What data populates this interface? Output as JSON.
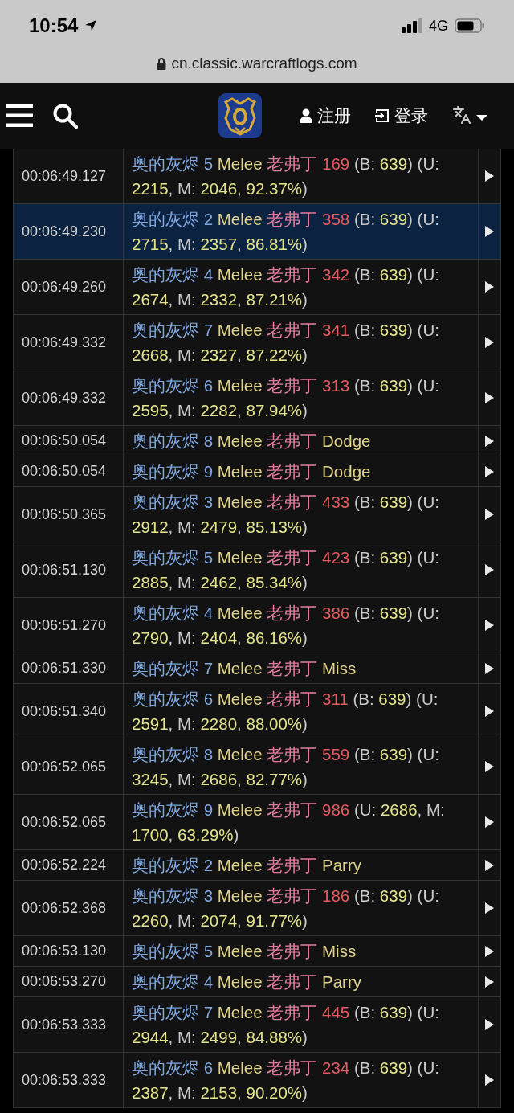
{
  "status_bar": {
    "time": "10:54",
    "network": "4G"
  },
  "address_bar": {
    "url": "cn.classic.warcraftlogs.com"
  },
  "nav": {
    "register": "注册",
    "login": "登录"
  },
  "events": [
    {
      "time": "00:06:49.127",
      "selected": false,
      "segments": [
        {
          "text": "奥的灰烬 5 ",
          "kind": "source"
        },
        {
          "text": "Melee ",
          "kind": "ability"
        },
        {
          "text": "老弗丁 ",
          "kind": "target"
        },
        {
          "text": "169",
          "kind": "damage"
        },
        {
          "text": " (B: ",
          "kind": "plain"
        },
        {
          "text": "639",
          "kind": "number"
        },
        {
          "text": ") (U: ",
          "kind": "plain"
        },
        {
          "text": "2215",
          "kind": "number"
        },
        {
          "text": ", M: ",
          "kind": "plain"
        },
        {
          "text": "2046",
          "kind": "number"
        },
        {
          "text": ", ",
          "kind": "plain"
        },
        {
          "text": "92.37%",
          "kind": "number"
        },
        {
          "text": ")",
          "kind": "plain"
        }
      ]
    },
    {
      "time": "00:06:49.230",
      "selected": true,
      "segments": [
        {
          "text": "奥的灰烬 2 ",
          "kind": "source"
        },
        {
          "text": "Melee ",
          "kind": "ability"
        },
        {
          "text": "老弗丁 ",
          "kind": "target"
        },
        {
          "text": "358",
          "kind": "damage"
        },
        {
          "text": " (B: ",
          "kind": "plain"
        },
        {
          "text": "639",
          "kind": "number"
        },
        {
          "text": ") (U: ",
          "kind": "plain"
        },
        {
          "text": "2715",
          "kind": "number"
        },
        {
          "text": ", M: ",
          "kind": "plain"
        },
        {
          "text": "2357",
          "kind": "number"
        },
        {
          "text": ", ",
          "kind": "plain"
        },
        {
          "text": "86.81%",
          "kind": "number"
        },
        {
          "text": ")",
          "kind": "plain"
        }
      ]
    },
    {
      "time": "00:06:49.260",
      "selected": false,
      "segments": [
        {
          "text": "奥的灰烬 4 ",
          "kind": "source"
        },
        {
          "text": "Melee ",
          "kind": "ability"
        },
        {
          "text": "老弗丁 ",
          "kind": "target"
        },
        {
          "text": "342",
          "kind": "damage"
        },
        {
          "text": " (B: ",
          "kind": "plain"
        },
        {
          "text": "639",
          "kind": "number"
        },
        {
          "text": ") (U: ",
          "kind": "plain"
        },
        {
          "text": "2674",
          "kind": "number"
        },
        {
          "text": ", M: ",
          "kind": "plain"
        },
        {
          "text": "2332",
          "kind": "number"
        },
        {
          "text": ", ",
          "kind": "plain"
        },
        {
          "text": "87.21%",
          "kind": "number"
        },
        {
          "text": ")",
          "kind": "plain"
        }
      ]
    },
    {
      "time": "00:06:49.332",
      "selected": false,
      "segments": [
        {
          "text": "奥的灰烬 7 ",
          "kind": "source"
        },
        {
          "text": "Melee ",
          "kind": "ability"
        },
        {
          "text": "老弗丁 ",
          "kind": "target"
        },
        {
          "text": "341",
          "kind": "damage"
        },
        {
          "text": " (B: ",
          "kind": "plain"
        },
        {
          "text": "639",
          "kind": "number"
        },
        {
          "text": ") (U: ",
          "kind": "plain"
        },
        {
          "text": "2668",
          "kind": "number"
        },
        {
          "text": ", M: ",
          "kind": "plain"
        },
        {
          "text": "2327",
          "kind": "number"
        },
        {
          "text": ", ",
          "kind": "plain"
        },
        {
          "text": "87.22%",
          "kind": "number"
        },
        {
          "text": ")",
          "kind": "plain"
        }
      ]
    },
    {
      "time": "00:06:49.332",
      "selected": false,
      "segments": [
        {
          "text": "奥的灰烬 6 ",
          "kind": "source"
        },
        {
          "text": "Melee ",
          "kind": "ability"
        },
        {
          "text": "老弗丁 ",
          "kind": "target"
        },
        {
          "text": "313",
          "kind": "damage"
        },
        {
          "text": " (B: ",
          "kind": "plain"
        },
        {
          "text": "639",
          "kind": "number"
        },
        {
          "text": ") (U: ",
          "kind": "plain"
        },
        {
          "text": "2595",
          "kind": "number"
        },
        {
          "text": ", M: ",
          "kind": "plain"
        },
        {
          "text": "2282",
          "kind": "number"
        },
        {
          "text": ", ",
          "kind": "plain"
        },
        {
          "text": "87.94%",
          "kind": "number"
        },
        {
          "text": ")",
          "kind": "plain"
        }
      ]
    },
    {
      "time": "00:06:50.054",
      "selected": false,
      "segments": [
        {
          "text": "奥的灰烬 8 ",
          "kind": "source"
        },
        {
          "text": "Melee ",
          "kind": "ability"
        },
        {
          "text": "老弗丁 ",
          "kind": "target"
        },
        {
          "text": "Dodge",
          "kind": "outcome"
        }
      ]
    },
    {
      "time": "00:06:50.054",
      "selected": false,
      "segments": [
        {
          "text": "奥的灰烬 9 ",
          "kind": "source"
        },
        {
          "text": "Melee ",
          "kind": "ability"
        },
        {
          "text": "老弗丁 ",
          "kind": "target"
        },
        {
          "text": "Dodge",
          "kind": "outcome"
        }
      ]
    },
    {
      "time": "00:06:50.365",
      "selected": false,
      "segments": [
        {
          "text": "奥的灰烬 3 ",
          "kind": "source"
        },
        {
          "text": "Melee ",
          "kind": "ability"
        },
        {
          "text": "老弗丁 ",
          "kind": "target"
        },
        {
          "text": "433",
          "kind": "damage"
        },
        {
          "text": " (B: ",
          "kind": "plain"
        },
        {
          "text": "639",
          "kind": "number"
        },
        {
          "text": ") (U: ",
          "kind": "plain"
        },
        {
          "text": "2912",
          "kind": "number"
        },
        {
          "text": ", M: ",
          "kind": "plain"
        },
        {
          "text": "2479",
          "kind": "number"
        },
        {
          "text": ", ",
          "kind": "plain"
        },
        {
          "text": "85.13%",
          "kind": "number"
        },
        {
          "text": ")",
          "kind": "plain"
        }
      ]
    },
    {
      "time": "00:06:51.130",
      "selected": false,
      "segments": [
        {
          "text": "奥的灰烬 5 ",
          "kind": "source"
        },
        {
          "text": "Melee ",
          "kind": "ability"
        },
        {
          "text": "老弗丁 ",
          "kind": "target"
        },
        {
          "text": "423",
          "kind": "damage"
        },
        {
          "text": " (B: ",
          "kind": "plain"
        },
        {
          "text": "639",
          "kind": "number"
        },
        {
          "text": ") (U: ",
          "kind": "plain"
        },
        {
          "text": "2885",
          "kind": "number"
        },
        {
          "text": ", M: ",
          "kind": "plain"
        },
        {
          "text": "2462",
          "kind": "number"
        },
        {
          "text": ", ",
          "kind": "plain"
        },
        {
          "text": "85.34%",
          "kind": "number"
        },
        {
          "text": ")",
          "kind": "plain"
        }
      ]
    },
    {
      "time": "00:06:51.270",
      "selected": false,
      "segments": [
        {
          "text": "奥的灰烬 4 ",
          "kind": "source"
        },
        {
          "text": "Melee ",
          "kind": "ability"
        },
        {
          "text": "老弗丁 ",
          "kind": "target"
        },
        {
          "text": "386",
          "kind": "damage"
        },
        {
          "text": " (B: ",
          "kind": "plain"
        },
        {
          "text": "639",
          "kind": "number"
        },
        {
          "text": ") (U: ",
          "kind": "plain"
        },
        {
          "text": "2790",
          "kind": "number"
        },
        {
          "text": ", M: ",
          "kind": "plain"
        },
        {
          "text": "2404",
          "kind": "number"
        },
        {
          "text": ", ",
          "kind": "plain"
        },
        {
          "text": "86.16%",
          "kind": "number"
        },
        {
          "text": ")",
          "kind": "plain"
        }
      ]
    },
    {
      "time": "00:06:51.330",
      "selected": false,
      "segments": [
        {
          "text": "奥的灰烬 7 ",
          "kind": "source"
        },
        {
          "text": "Melee ",
          "kind": "ability"
        },
        {
          "text": "老弗丁 ",
          "kind": "target"
        },
        {
          "text": "Miss",
          "kind": "outcome"
        }
      ]
    },
    {
      "time": "00:06:51.340",
      "selected": false,
      "segments": [
        {
          "text": "奥的灰烬 6 ",
          "kind": "source"
        },
        {
          "text": "Melee ",
          "kind": "ability"
        },
        {
          "text": "老弗丁 ",
          "kind": "target"
        },
        {
          "text": "311",
          "kind": "damage"
        },
        {
          "text": " (B: ",
          "kind": "plain"
        },
        {
          "text": "639",
          "kind": "number"
        },
        {
          "text": ") (U: ",
          "kind": "plain"
        },
        {
          "text": "2591",
          "kind": "number"
        },
        {
          "text": ", M: ",
          "kind": "plain"
        },
        {
          "text": "2280",
          "kind": "number"
        },
        {
          "text": ", ",
          "kind": "plain"
        },
        {
          "text": "88.00%",
          "kind": "number"
        },
        {
          "text": ")",
          "kind": "plain"
        }
      ]
    },
    {
      "time": "00:06:52.065",
      "selected": false,
      "segments": [
        {
          "text": "奥的灰烬 8 ",
          "kind": "source"
        },
        {
          "text": "Melee ",
          "kind": "ability"
        },
        {
          "text": "老弗丁 ",
          "kind": "target"
        },
        {
          "text": "559",
          "kind": "damage"
        },
        {
          "text": " (B: ",
          "kind": "plain"
        },
        {
          "text": "639",
          "kind": "number"
        },
        {
          "text": ") (U: ",
          "kind": "plain"
        },
        {
          "text": "3245",
          "kind": "number"
        },
        {
          "text": ", M: ",
          "kind": "plain"
        },
        {
          "text": "2686",
          "kind": "number"
        },
        {
          "text": ", ",
          "kind": "plain"
        },
        {
          "text": "82.77%",
          "kind": "number"
        },
        {
          "text": ")",
          "kind": "plain"
        }
      ]
    },
    {
      "time": "00:06:52.065",
      "selected": false,
      "segments": [
        {
          "text": "奥的灰烬 9 ",
          "kind": "source"
        },
        {
          "text": "Melee ",
          "kind": "ability"
        },
        {
          "text": "老弗丁 ",
          "kind": "target"
        },
        {
          "text": "986",
          "kind": "damage"
        },
        {
          "text": " (U: ",
          "kind": "plain"
        },
        {
          "text": "2686",
          "kind": "number"
        },
        {
          "text": ", M: ",
          "kind": "plain"
        },
        {
          "text": "1700",
          "kind": "number"
        },
        {
          "text": ", ",
          "kind": "plain"
        },
        {
          "text": "63.29%",
          "kind": "number"
        },
        {
          "text": ")",
          "kind": "plain"
        }
      ]
    },
    {
      "time": "00:06:52.224",
      "selected": false,
      "segments": [
        {
          "text": "奥的灰烬 2 ",
          "kind": "source"
        },
        {
          "text": "Melee ",
          "kind": "ability"
        },
        {
          "text": "老弗丁 ",
          "kind": "target"
        },
        {
          "text": "Parry",
          "kind": "outcome"
        }
      ]
    },
    {
      "time": "00:06:52.368",
      "selected": false,
      "segments": [
        {
          "text": "奥的灰烬 3 ",
          "kind": "source"
        },
        {
          "text": "Melee ",
          "kind": "ability"
        },
        {
          "text": "老弗丁 ",
          "kind": "target"
        },
        {
          "text": "186",
          "kind": "damage"
        },
        {
          "text": " (B: ",
          "kind": "plain"
        },
        {
          "text": "639",
          "kind": "number"
        },
        {
          "text": ") (U: ",
          "kind": "plain"
        },
        {
          "text": "2260",
          "kind": "number"
        },
        {
          "text": ", M: ",
          "kind": "plain"
        },
        {
          "text": "2074",
          "kind": "number"
        },
        {
          "text": ", ",
          "kind": "plain"
        },
        {
          "text": "91.77%",
          "kind": "number"
        },
        {
          "text": ")",
          "kind": "plain"
        }
      ]
    },
    {
      "time": "00:06:53.130",
      "selected": false,
      "segments": [
        {
          "text": "奥的灰烬 5 ",
          "kind": "source"
        },
        {
          "text": "Melee ",
          "kind": "ability"
        },
        {
          "text": "老弗丁 ",
          "kind": "target"
        },
        {
          "text": "Miss",
          "kind": "outcome"
        }
      ]
    },
    {
      "time": "00:06:53.270",
      "selected": false,
      "segments": [
        {
          "text": "奥的灰烬 4 ",
          "kind": "source"
        },
        {
          "text": "Melee ",
          "kind": "ability"
        },
        {
          "text": "老弗丁 ",
          "kind": "target"
        },
        {
          "text": "Parry",
          "kind": "outcome"
        }
      ]
    },
    {
      "time": "00:06:53.333",
      "selected": false,
      "segments": [
        {
          "text": "奥的灰烬 7 ",
          "kind": "source"
        },
        {
          "text": "Melee ",
          "kind": "ability"
        },
        {
          "text": "老弗丁 ",
          "kind": "target"
        },
        {
          "text": "445",
          "kind": "damage"
        },
        {
          "text": " (B: ",
          "kind": "plain"
        },
        {
          "text": "639",
          "kind": "number"
        },
        {
          "text": ") (U: ",
          "kind": "plain"
        },
        {
          "text": "2944",
          "kind": "number"
        },
        {
          "text": ", M: ",
          "kind": "plain"
        },
        {
          "text": "2499",
          "kind": "number"
        },
        {
          "text": ", ",
          "kind": "plain"
        },
        {
          "text": "84.88%",
          "kind": "number"
        },
        {
          "text": ")",
          "kind": "plain"
        }
      ]
    },
    {
      "time": "00:06:53.333",
      "selected": false,
      "segments": [
        {
          "text": "奥的灰烬 6 ",
          "kind": "source"
        },
        {
          "text": "Melee ",
          "kind": "ability"
        },
        {
          "text": "老弗丁 ",
          "kind": "target"
        },
        {
          "text": "234",
          "kind": "damage"
        },
        {
          "text": " (B: ",
          "kind": "plain"
        },
        {
          "text": "639",
          "kind": "number"
        },
        {
          "text": ") (U: ",
          "kind": "plain"
        },
        {
          "text": "2387",
          "kind": "number"
        },
        {
          "text": ", M: ",
          "kind": "plain"
        },
        {
          "text": "2153",
          "kind": "number"
        },
        {
          "text": ", ",
          "kind": "plain"
        },
        {
          "text": "90.20%",
          "kind": "number"
        },
        {
          "text": ")",
          "kind": "plain"
        }
      ]
    }
  ]
}
